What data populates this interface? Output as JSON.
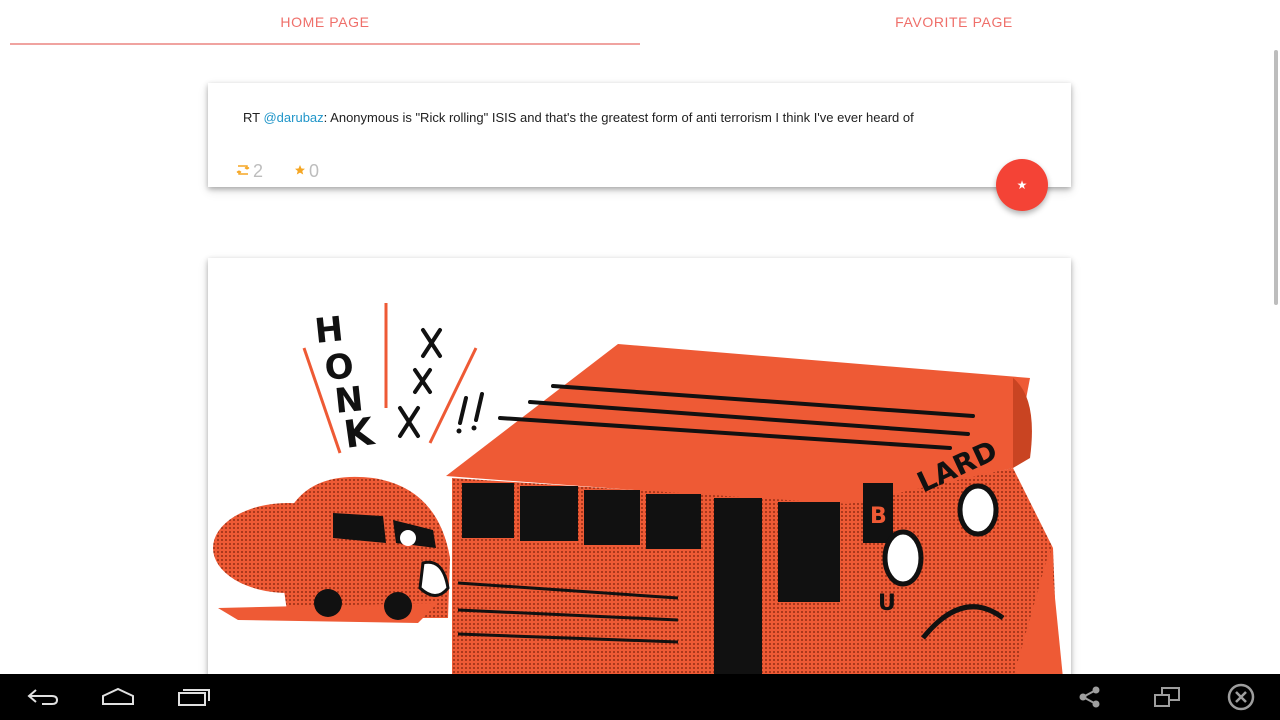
{
  "tabs": {
    "home_label": "HOME PAGE",
    "favorite_label": "FAVORITE PAGE"
  },
  "tweet": {
    "prefix": "RT ",
    "mention": "@darubaz",
    "text": ": Anonymous is \"Rick rolling\" ISIS and that's the greatest form of anti terrorism I think I've ever heard of",
    "retweet_count": "2",
    "favorite_count": "0"
  },
  "fab": {
    "icon": "star-icon",
    "glyph": "★"
  },
  "illustration": {
    "honk": [
      "H",
      "O",
      "N",
      "K"
    ],
    "bus_sign": "LARD",
    "bus_front_letters": [
      "B",
      "U"
    ]
  },
  "colors": {
    "accent": "#ef6f6a",
    "mention": "#2196c9",
    "retweet_icon": "#f5a623",
    "favorite_icon": "#f5a623",
    "fab": "#f44336",
    "illustration_orange": "#ee5a35"
  },
  "navbar": {
    "icons": [
      "back-icon",
      "home-icon",
      "recent-apps-icon",
      "share-icon",
      "screen-mirror-icon",
      "close-icon"
    ]
  }
}
